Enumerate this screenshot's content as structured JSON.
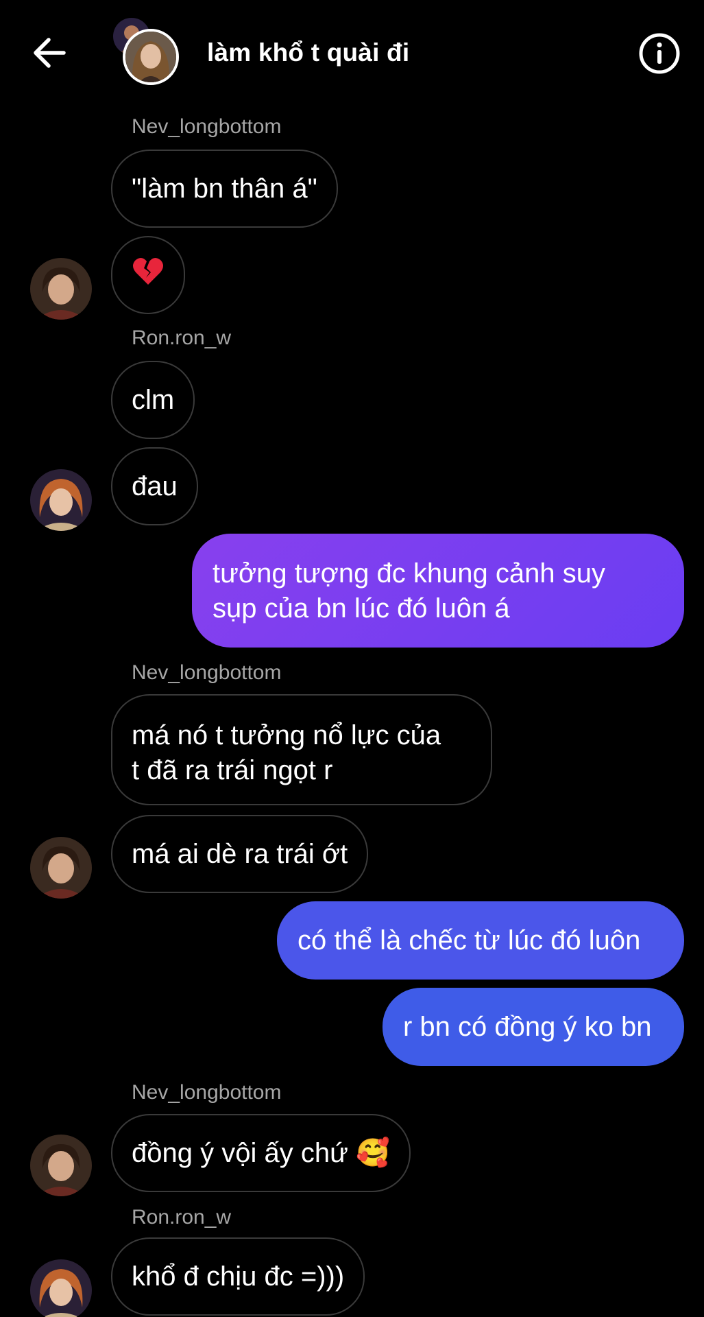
{
  "header": {
    "title": "làm khổ t quài đi",
    "back_icon": "arrow-left-icon",
    "info_icon": "info-circle-icon"
  },
  "colors": {
    "background": "#000000",
    "incoming_border": "#3a3a3a",
    "sender_name": "#a7a7a7",
    "outgoing_purple": "#7b3df0",
    "outgoing_blue": "#4a57ea"
  },
  "messages": [
    {
      "type": "sender",
      "text": "Nev_longbottom"
    },
    {
      "type": "incoming",
      "text": "\"làm bn thân á\""
    },
    {
      "type": "incoming",
      "text": "💔"
    },
    {
      "type": "sender",
      "text": "Ron.ron_w"
    },
    {
      "type": "incoming",
      "text": "clm"
    },
    {
      "type": "incoming",
      "text": "đau"
    },
    {
      "type": "outgoing",
      "lines": [
        "tưởng tượng đc khung cảnh suy",
        "sụp của bn lúc đó luôn á"
      ]
    },
    {
      "type": "sender",
      "text": "Nev_longbottom"
    },
    {
      "type": "incoming",
      "lines": [
        "má nó t tưởng nổ lực của",
        "t đã ra trái ngọt r"
      ]
    },
    {
      "type": "incoming",
      "text": "má ai dè ra trái ớt"
    },
    {
      "type": "outgoing",
      "text": "có thể là chếc từ lúc đó luôn"
    },
    {
      "type": "outgoing",
      "text": "r bn có đồng ý ko bn"
    },
    {
      "type": "sender",
      "text": "Nev_longbottom"
    },
    {
      "type": "incoming",
      "text": "đồng ý vội ấy chứ 🥰"
    },
    {
      "type": "sender",
      "text": "Ron.ron_w"
    },
    {
      "type": "incoming",
      "text": "khổ đ chịu đc =)))"
    }
  ]
}
